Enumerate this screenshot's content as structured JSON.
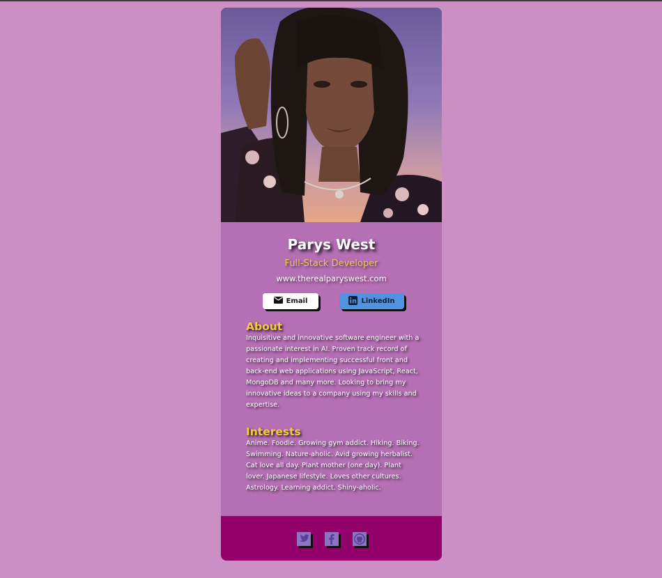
{
  "profile": {
    "name": "Parys West",
    "title": "Full-Stack Developer",
    "website": "www.therealparyswest.com"
  },
  "buttons": {
    "email_label": "Email",
    "linkedin_label": "LinkedIn"
  },
  "about": {
    "heading": "About",
    "text": "Inquisitive and innovative software engineer with a passionate interest in AI. Proven track record of creating and implementing successful front and back-end web applications using JavaScript, React, MongoDB and many more. Looking to bring my innovative ideas to a company using my skills and expertise."
  },
  "interests": {
    "heading": "Interests",
    "text": "Anime. Foodie. Growing gym addict. Hiking. Biking. Swimming. Nature-aholic. Avid growing herbalist. Cat love all day. Plant mother (one day). Plant lover. Japanese lifestyle. Loves other cultures. Astrology. Learning addict. Shiny-aholic."
  },
  "footer": {
    "icons": [
      "twitter-icon",
      "facebook-icon",
      "github-icon"
    ]
  },
  "colors": {
    "page_background": "#cc8fc5",
    "card_background": "#b56fb4",
    "footer_background": "#930069",
    "accent_yellow": "#f8c93c",
    "title_orange": "#f6c44e",
    "linkedin_blue": "#5093e1",
    "social_icon_bg": "#8d74c2"
  }
}
